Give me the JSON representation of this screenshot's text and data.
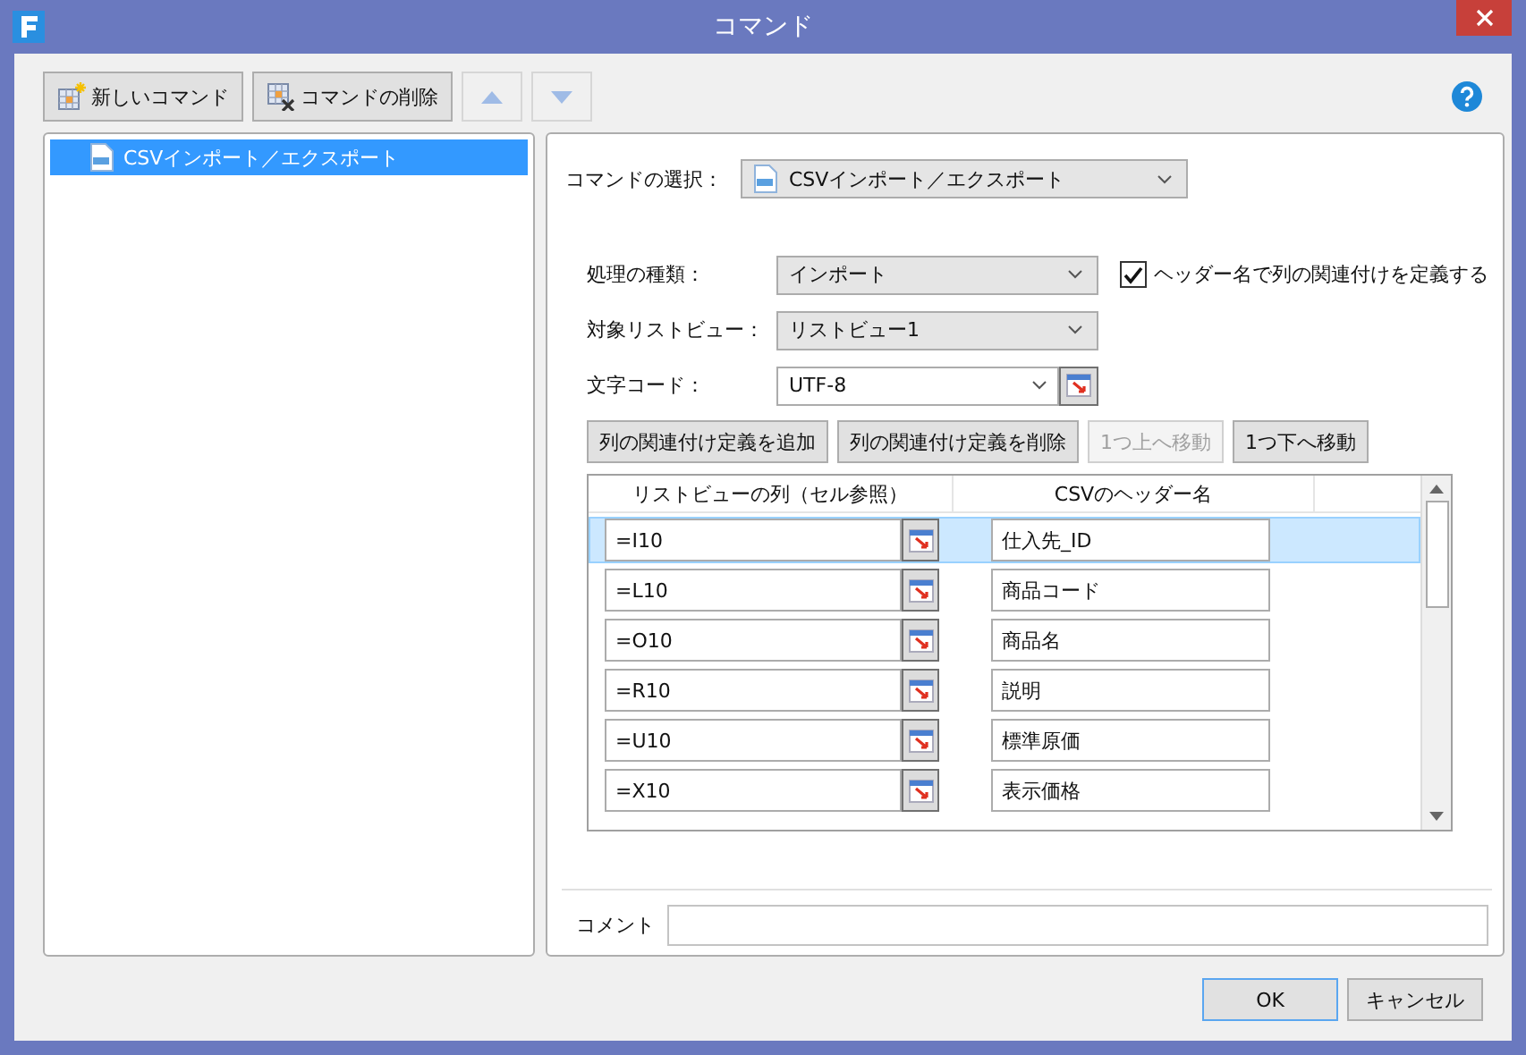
{
  "window": {
    "title": "コマンド"
  },
  "toolbar": {
    "buttons": [
      {
        "label": "新しいコマンド",
        "kind": "new"
      },
      {
        "label": "コマンドの削除",
        "kind": "delete"
      }
    ],
    "arrow_buttons": [
      {
        "kind": "up",
        "disabled": true
      },
      {
        "kind": "down",
        "disabled": true
      }
    ]
  },
  "sidebar": {
    "items": [
      {
        "label": "CSVインポート／エクスポート",
        "selected": true
      }
    ]
  },
  "command_select": {
    "label": "コマンドの選択：",
    "value": "CSVインポート／エクスポート"
  },
  "form": {
    "process_type": {
      "label": "処理の種類：",
      "value": "インポート"
    },
    "header_mapping": {
      "label": "ヘッダー名で列の関連付けを定義する",
      "checked": true
    },
    "target_listview": {
      "label": "対象リストビュー：",
      "value": "リストビュー1"
    },
    "encoding": {
      "label": "文字コード：",
      "value": "UTF-8"
    }
  },
  "mapping_buttons": [
    {
      "label": "列の関連付け定義を追加",
      "disabled": false
    },
    {
      "label": "列の関連付け定義を削除",
      "disabled": false
    },
    {
      "label": "1つ上へ移動",
      "disabled": true
    },
    {
      "label": "1つ下へ移動",
      "disabled": false
    }
  ],
  "table": {
    "columns": [
      "リストビューの列（セル参照）",
      "CSVのヘッダー名"
    ],
    "rows": [
      {
        "cell": "=I10",
        "header": "仕入先_ID",
        "selected": true
      },
      {
        "cell": "=L10",
        "header": "商品コード",
        "selected": false
      },
      {
        "cell": "=O10",
        "header": "商品名",
        "selected": false
      },
      {
        "cell": "=R10",
        "header": "説明",
        "selected": false
      },
      {
        "cell": "=U10",
        "header": "標準原価",
        "selected": false
      },
      {
        "cell": "=X10",
        "header": "表示価格",
        "selected": false
      }
    ]
  },
  "comment": {
    "label": "コメント"
  },
  "buttons": [
    {
      "label": "OK",
      "default": true
    },
    {
      "label": "キャンセル",
      "default": false
    }
  ]
}
